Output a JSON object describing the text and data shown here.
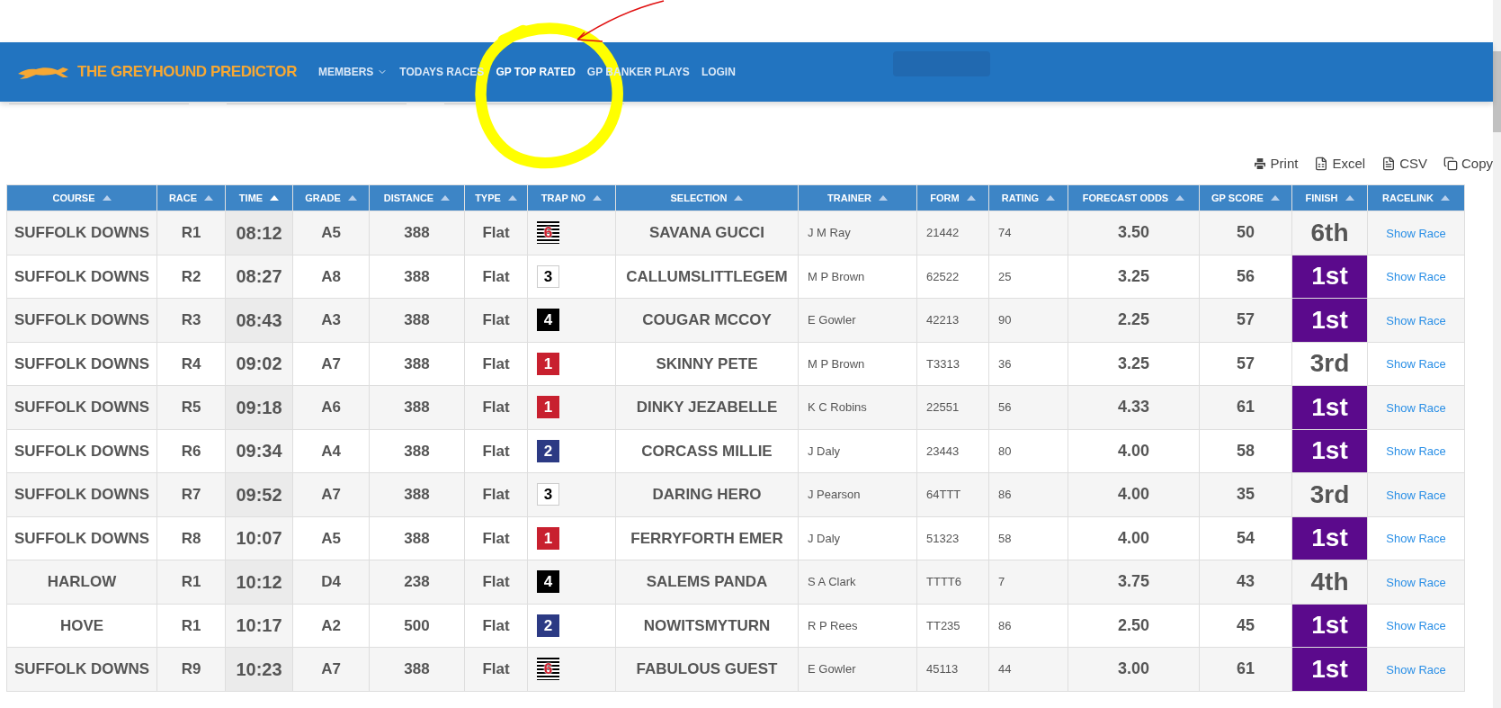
{
  "nav": {
    "brand": "THE GREYHOUND PREDICTOR",
    "items": [
      {
        "label": "MEMBERS",
        "dropdown": true
      },
      {
        "label": "TODAYS RACES",
        "dropdown": false
      },
      {
        "label": "GP TOP RATED",
        "dropdown": false
      },
      {
        "label": "GP BANKER PLAYS",
        "dropdown": false
      },
      {
        "label": "LOGIN",
        "dropdown": false
      }
    ]
  },
  "export_buttons": [
    {
      "label": "Print",
      "kind": "print"
    },
    {
      "label": "Excel",
      "kind": "excel"
    },
    {
      "label": "CSV",
      "kind": "csv"
    },
    {
      "label": "Copy",
      "kind": "copy"
    }
  ],
  "table": {
    "columns": [
      {
        "label": "COURSE",
        "sorted": false
      },
      {
        "label": "RACE",
        "sorted": false
      },
      {
        "label": "TIME",
        "sorted": true
      },
      {
        "label": "GRADE",
        "sorted": false
      },
      {
        "label": "DISTANCE",
        "sorted": false
      },
      {
        "label": "TYPE",
        "sorted": false
      },
      {
        "label": "TRAP NO",
        "sorted": false
      },
      {
        "label": "SELECTION",
        "sorted": false
      },
      {
        "label": "TRAINER",
        "sorted": false
      },
      {
        "label": "FORM",
        "sorted": false
      },
      {
        "label": "RATING",
        "sorted": false
      },
      {
        "label": "FORECAST ODDS",
        "sorted": false
      },
      {
        "label": "GP SCORE",
        "sorted": false
      },
      {
        "label": "FINISH",
        "sorted": false
      },
      {
        "label": "RACELINK",
        "sorted": false
      }
    ],
    "rows": [
      {
        "course": "SUFFOLK DOWNS",
        "race": "R1",
        "time": "08:12",
        "grade": "A5",
        "distance": "388",
        "type": "Flat",
        "trap": {
          "number": "6",
          "kind": "striped"
        },
        "selection": "SAVANA GUCCI",
        "trainer": "J M Ray",
        "form": "21442",
        "rating": "74",
        "odds": "3.50",
        "score": "50",
        "finish": "6th",
        "winner": false,
        "link": "Show Race"
      },
      {
        "course": "SUFFOLK DOWNS",
        "race": "R2",
        "time": "08:27",
        "grade": "A8",
        "distance": "388",
        "type": "Flat",
        "trap": {
          "number": "3",
          "kind": "white"
        },
        "selection": "CALLUMSLITTLEGEM",
        "trainer": "M P Brown",
        "form": "62522",
        "rating": "25",
        "odds": "3.25",
        "score": "56",
        "finish": "1st",
        "winner": true,
        "link": "Show Race"
      },
      {
        "course": "SUFFOLK DOWNS",
        "race": "R3",
        "time": "08:43",
        "grade": "A3",
        "distance": "388",
        "type": "Flat",
        "trap": {
          "number": "4",
          "kind": "black"
        },
        "selection": "COUGAR MCCOY",
        "trainer": "E Gowler",
        "form": "42213",
        "rating": "90",
        "odds": "2.25",
        "score": "57",
        "finish": "1st",
        "winner": true,
        "link": "Show Race"
      },
      {
        "course": "SUFFOLK DOWNS",
        "race": "R4",
        "time": "09:02",
        "grade": "A7",
        "distance": "388",
        "type": "Flat",
        "trap": {
          "number": "1",
          "kind": "red"
        },
        "selection": "SKINNY PETE",
        "trainer": "M P Brown",
        "form": "T3313",
        "rating": "36",
        "odds": "3.25",
        "score": "57",
        "finish": "3rd",
        "winner": false,
        "link": "Show Race"
      },
      {
        "course": "SUFFOLK DOWNS",
        "race": "R5",
        "time": "09:18",
        "grade": "A6",
        "distance": "388",
        "type": "Flat",
        "trap": {
          "number": "1",
          "kind": "red"
        },
        "selection": "DINKY JEZABELLE",
        "trainer": "K C Robins",
        "form": "22551",
        "rating": "56",
        "odds": "4.33",
        "score": "61",
        "finish": "1st",
        "winner": true,
        "link": "Show Race"
      },
      {
        "course": "SUFFOLK DOWNS",
        "race": "R6",
        "time": "09:34",
        "grade": "A4",
        "distance": "388",
        "type": "Flat",
        "trap": {
          "number": "2",
          "kind": "blue"
        },
        "selection": "CORCASS MILLIE",
        "trainer": "J Daly",
        "form": "23443",
        "rating": "80",
        "odds": "4.00",
        "score": "58",
        "finish": "1st",
        "winner": true,
        "link": "Show Race"
      },
      {
        "course": "SUFFOLK DOWNS",
        "race": "R7",
        "time": "09:52",
        "grade": "A7",
        "distance": "388",
        "type": "Flat",
        "trap": {
          "number": "3",
          "kind": "white"
        },
        "selection": "DARING HERO",
        "trainer": "J Pearson",
        "form": "64TTT",
        "rating": "86",
        "odds": "4.00",
        "score": "35",
        "finish": "3rd",
        "winner": false,
        "link": "Show Race"
      },
      {
        "course": "SUFFOLK DOWNS",
        "race": "R8",
        "time": "10:07",
        "grade": "A5",
        "distance": "388",
        "type": "Flat",
        "trap": {
          "number": "1",
          "kind": "red"
        },
        "selection": "FERRYFORTH EMER",
        "trainer": "J Daly",
        "form": "51323",
        "rating": "58",
        "odds": "4.00",
        "score": "54",
        "finish": "1st",
        "winner": true,
        "link": "Show Race"
      },
      {
        "course": "HARLOW",
        "race": "R1",
        "time": "10:12",
        "grade": "D4",
        "distance": "238",
        "type": "Flat",
        "trap": {
          "number": "4",
          "kind": "black"
        },
        "selection": "SALEMS PANDA",
        "trainer": "S A Clark",
        "form": "TTTT6",
        "rating": "7",
        "odds": "3.75",
        "score": "43",
        "finish": "4th",
        "winner": false,
        "link": "Show Race"
      },
      {
        "course": "HOVE",
        "race": "R1",
        "time": "10:17",
        "grade": "A2",
        "distance": "500",
        "type": "Flat",
        "trap": {
          "number": "2",
          "kind": "blue"
        },
        "selection": "NOWITSMYTURN",
        "trainer": "R P Rees",
        "form": "TT235",
        "rating": "86",
        "odds": "2.50",
        "score": "45",
        "finish": "1st",
        "winner": true,
        "link": "Show Race"
      },
      {
        "course": "SUFFOLK DOWNS",
        "race": "R9",
        "time": "10:23",
        "grade": "A7",
        "distance": "388",
        "type": "Flat",
        "trap": {
          "number": "6",
          "kind": "striped"
        },
        "selection": "FABULOUS GUEST",
        "trainer": "E Gowler",
        "form": "45113",
        "rating": "44",
        "odds": "3.00",
        "score": "61",
        "finish": "1st",
        "winner": true,
        "link": "Show Race"
      }
    ]
  }
}
